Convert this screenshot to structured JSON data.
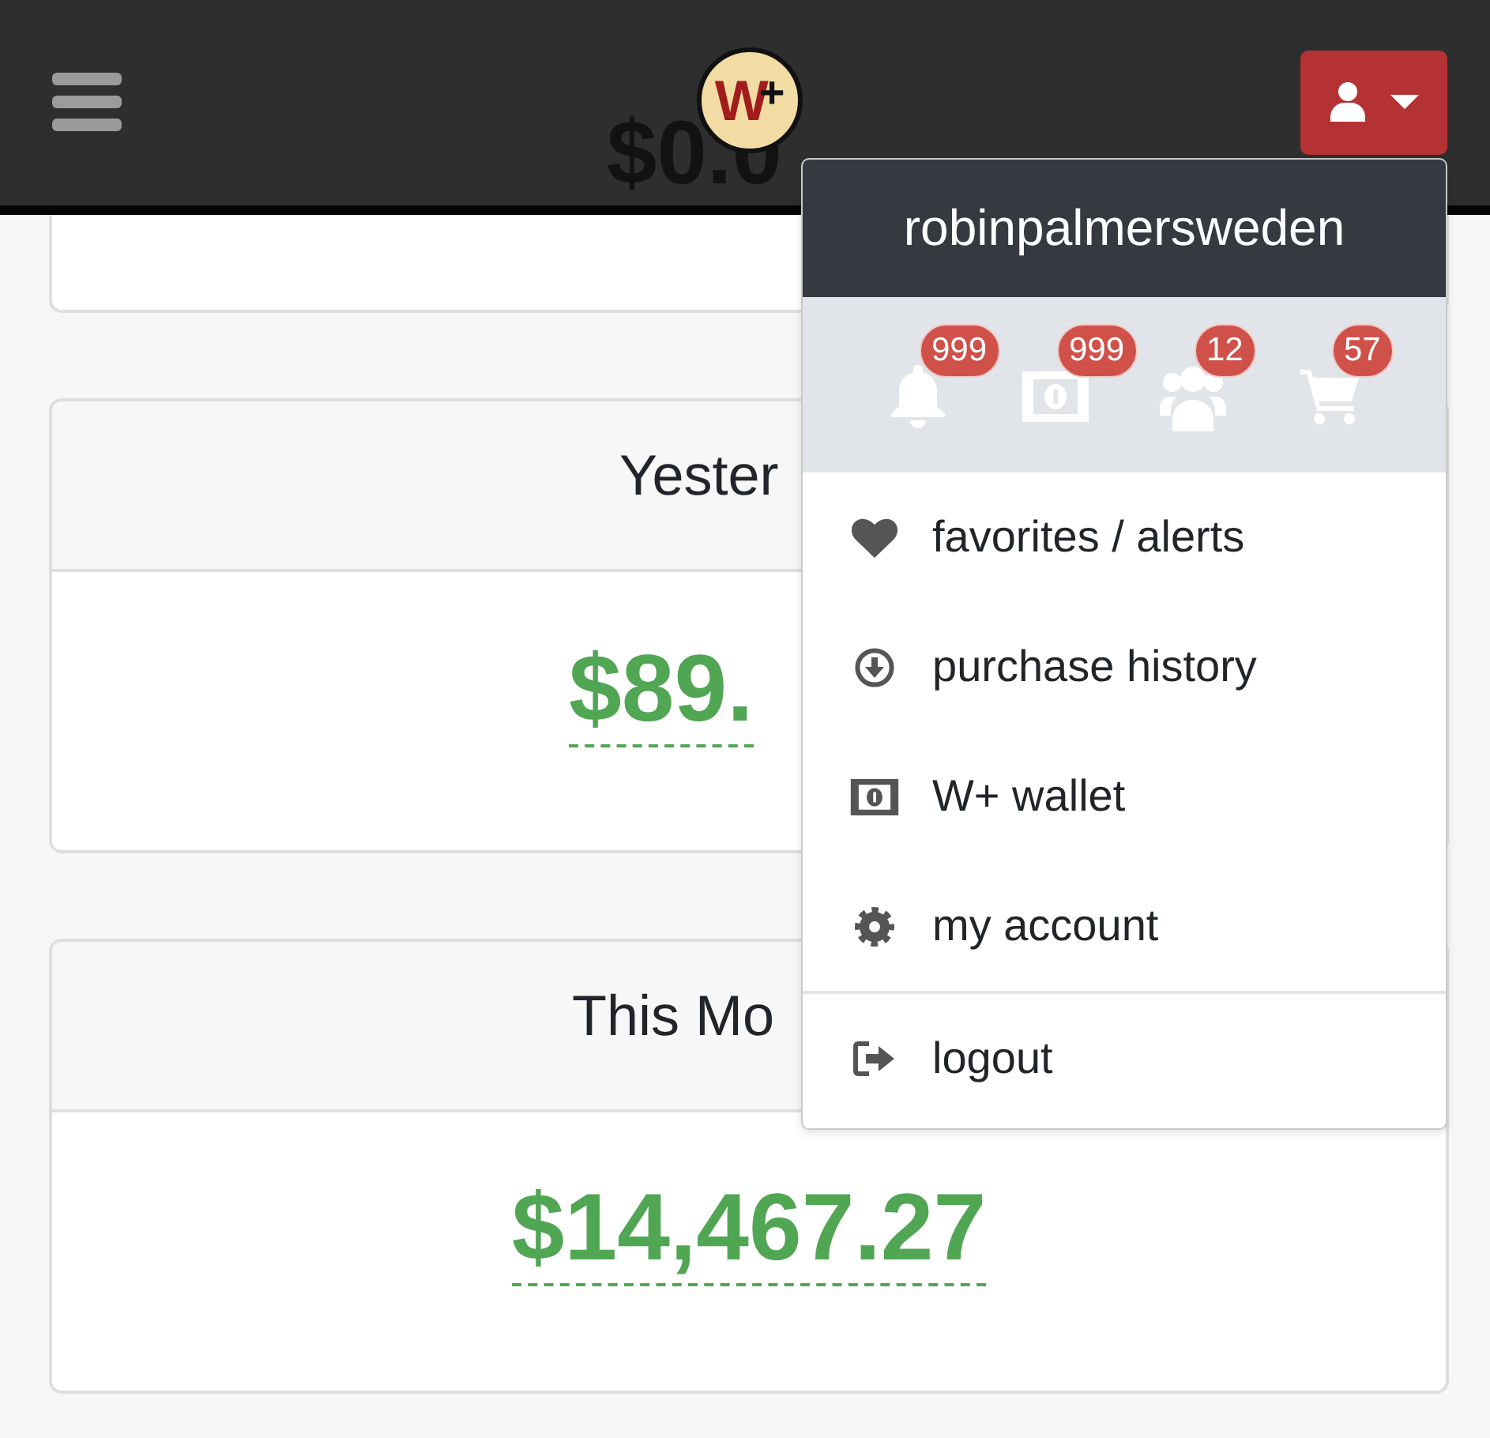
{
  "navbar": {
    "logo": {
      "letter": "W",
      "mark": "+"
    }
  },
  "cards": [
    {
      "value": "$0.0"
    },
    {
      "title": "Yester",
      "value": "$89."
    },
    {
      "title": "This Mo",
      "value": "$14,467.27"
    }
  ],
  "dropdown": {
    "username": "robinpalmersweden",
    "counters": [
      {
        "kind": "bell",
        "badge": "999"
      },
      {
        "kind": "money",
        "badge": "999"
      },
      {
        "kind": "users",
        "badge": "12"
      },
      {
        "kind": "cart",
        "badge": "57"
      }
    ],
    "sections": [
      {
        "items": [
          {
            "kind": "heart",
            "label": "favorites / alerts"
          },
          {
            "kind": "download",
            "label": "purchase history"
          },
          {
            "kind": "money",
            "label": "W+ wallet"
          },
          {
            "kind": "gear",
            "label": "my account"
          }
        ]
      },
      {
        "items": [
          {
            "kind": "sign-out",
            "label": "logout"
          }
        ]
      }
    ]
  }
}
